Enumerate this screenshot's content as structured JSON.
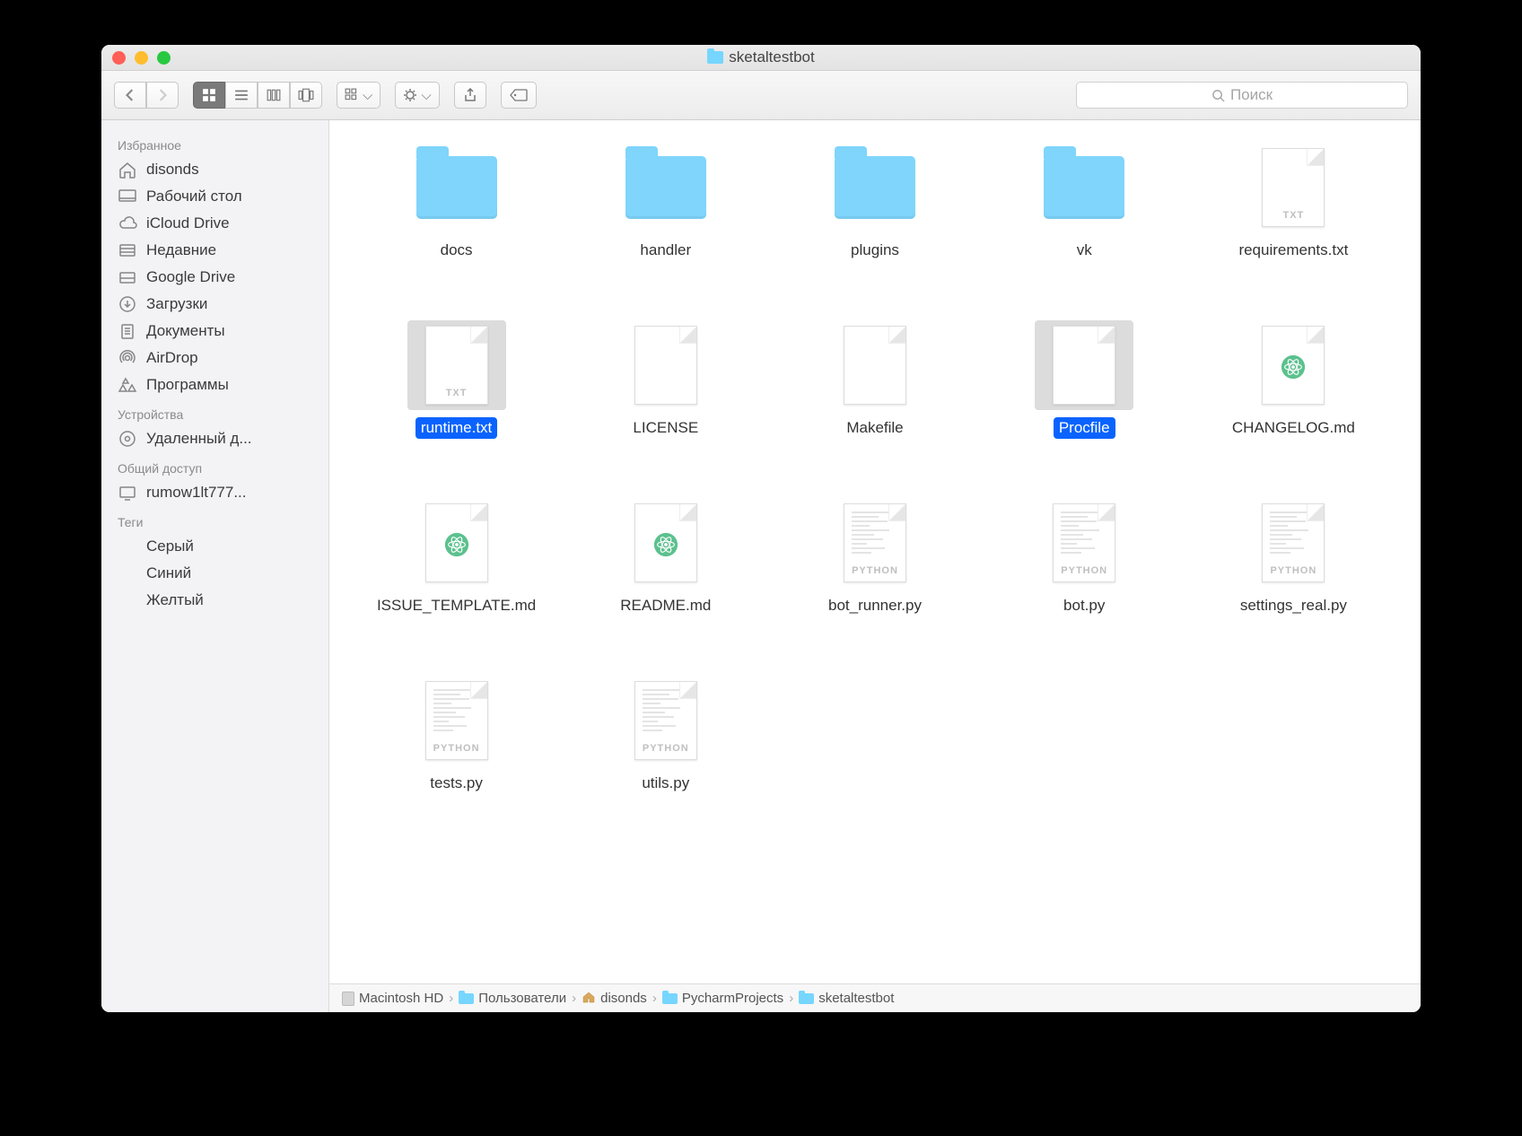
{
  "window": {
    "title": "sketaltestbot"
  },
  "toolbar": {
    "search_placeholder": "Поиск"
  },
  "sidebar": {
    "sections": [
      {
        "title": "Избранное",
        "items": [
          {
            "icon": "home",
            "label": "disonds"
          },
          {
            "icon": "desktop",
            "label": "Рабочий стол"
          },
          {
            "icon": "cloud",
            "label": "iCloud Drive"
          },
          {
            "icon": "recent",
            "label": "Недавние"
          },
          {
            "icon": "gdrive",
            "label": "Google Drive"
          },
          {
            "icon": "downloads",
            "label": "Загрузки"
          },
          {
            "icon": "documents",
            "label": "Документы"
          },
          {
            "icon": "airdrop",
            "label": "AirDrop"
          },
          {
            "icon": "apps",
            "label": "Программы"
          }
        ]
      },
      {
        "title": "Устройства",
        "items": [
          {
            "icon": "disc",
            "label": "Удаленный д..."
          }
        ]
      },
      {
        "title": "Общий доступ",
        "items": [
          {
            "icon": "pc",
            "label": "rumow1lt777..."
          }
        ]
      },
      {
        "title": "Теги",
        "items": [
          {
            "icon": "tag",
            "color": "#9a9a9a",
            "label": "Серый"
          },
          {
            "icon": "tag",
            "color": "#1d93f3",
            "label": "Синий"
          },
          {
            "icon": "tag",
            "color": "#f6bd27",
            "label": "Желтый"
          }
        ]
      }
    ]
  },
  "files": [
    {
      "name": "docs",
      "type": "folder",
      "selected": false
    },
    {
      "name": "handler",
      "type": "folder",
      "selected": false
    },
    {
      "name": "plugins",
      "type": "folder",
      "selected": false
    },
    {
      "name": "vk",
      "type": "folder",
      "selected": false
    },
    {
      "name": "requirements.txt",
      "type": "txt",
      "selected": false
    },
    {
      "name": "runtime.txt",
      "type": "txt",
      "selected": true
    },
    {
      "name": "LICENSE",
      "type": "blank",
      "selected": false
    },
    {
      "name": "Makefile",
      "type": "blank",
      "selected": false
    },
    {
      "name": "Procfile",
      "type": "blank",
      "selected": true
    },
    {
      "name": "CHANGELOG.md",
      "type": "md",
      "selected": false
    },
    {
      "name": "ISSUE_TEMPLATE.md",
      "type": "md",
      "selected": false
    },
    {
      "name": "README.md",
      "type": "md",
      "selected": false
    },
    {
      "name": "bot_runner.py",
      "type": "py",
      "selected": false
    },
    {
      "name": "bot.py",
      "type": "py",
      "selected": false
    },
    {
      "name": "settings_real.py",
      "type": "py",
      "selected": false
    },
    {
      "name": "tests.py",
      "type": "py",
      "selected": false
    },
    {
      "name": "utils.py",
      "type": "py",
      "selected": false
    }
  ],
  "pathbar": [
    {
      "icon": "hd",
      "label": "Macintosh HD"
    },
    {
      "icon": "folder",
      "label": "Пользователи"
    },
    {
      "icon": "home",
      "label": "disonds"
    },
    {
      "icon": "folder",
      "label": "PycharmProjects"
    },
    {
      "icon": "folder",
      "label": "sketaltestbot"
    }
  ]
}
